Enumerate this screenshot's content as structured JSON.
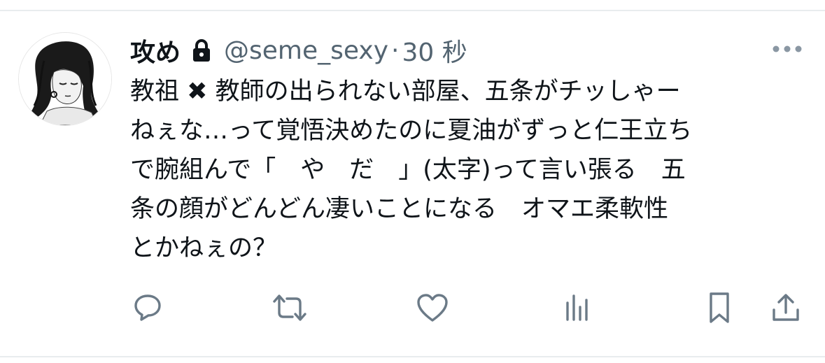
{
  "tweet": {
    "display_name": "攻め",
    "handle": "@seme_sexy",
    "separator": "·",
    "timestamp": "30 秒",
    "text_lines": [
      "教祖 ✖ 教師の出られない部屋、五条がチッしゃー",
      "ねぇな…って覚悟決めたのに夏油がずっと仁王立ち",
      "で腕組んで「　や　だ　」(太字)って言い張る　五",
      "条の顔がどんどん凄いことになる　オマエ柔軟性",
      "とかねぇの？"
    ]
  },
  "icons": {
    "lock": "lock-icon",
    "more": "more-icon",
    "reply": "reply-icon",
    "retweet": "retweet-icon",
    "like": "like-icon",
    "views": "views-icon",
    "bookmark": "bookmark-icon",
    "share": "share-icon"
  },
  "colors": {
    "text_primary": "#0f1419",
    "text_secondary": "#536471",
    "divider": "#e8ecee"
  }
}
